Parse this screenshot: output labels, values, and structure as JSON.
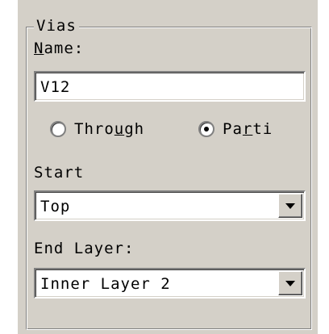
{
  "vias": {
    "group_title": "Vias",
    "name_label_u": "N",
    "name_label_rest": "ame:",
    "name_value": "V12",
    "radio_through_pre": "Thro",
    "radio_through_u": "u",
    "radio_through_post": "gh",
    "radio_through_selected": false,
    "radio_partial_pre": "Pa",
    "radio_partial_u": "r",
    "radio_partial_post": "ti",
    "radio_partial_selected": true,
    "start_label": "Start",
    "start_value": "Top",
    "end_label": "End Layer:",
    "end_value": "Inner Layer 2"
  }
}
